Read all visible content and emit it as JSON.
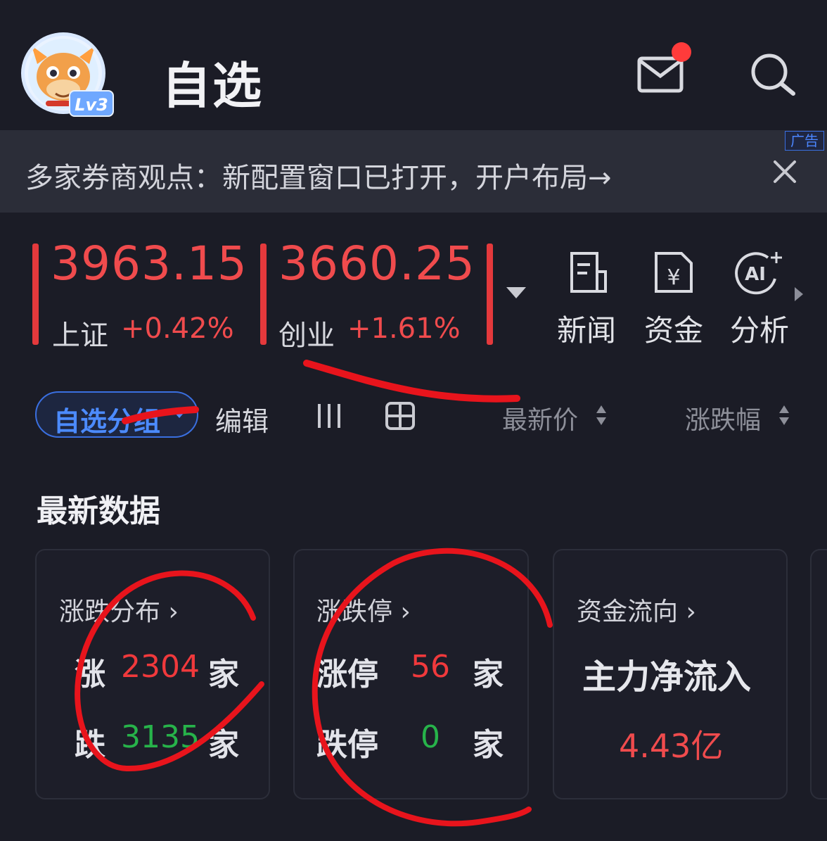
{
  "header": {
    "title": "自选",
    "level_badge": "Lv3",
    "icons": [
      "avatar",
      "mail-icon",
      "search-icon"
    ],
    "has_notification": true
  },
  "ad_banner": {
    "text": "多家券商观点：新配置窗口已打开，开户布局→",
    "tag": "广告"
  },
  "indices": [
    {
      "value": "3963.15",
      "name": "上证",
      "change": "+0.42%"
    },
    {
      "value": "3660.25",
      "name": "创业",
      "change": "+1.61%"
    }
  ],
  "tools": [
    {
      "label": "新闻",
      "icon": "news-icon"
    },
    {
      "label": "资金",
      "icon": "fund-yen-icon"
    },
    {
      "label": "分析",
      "icon": "ai-analysis-icon"
    }
  ],
  "filter_bar": {
    "group_label": "自选分组",
    "edit_label": "编辑",
    "sort_price": "最新价",
    "sort_change": "涨跌幅"
  },
  "section": {
    "title": "最新数据"
  },
  "cards": {
    "distribution": {
      "title": "涨跌分布",
      "rise_label": "涨",
      "rise_count": "2304",
      "fall_label": "跌",
      "fall_count": "3135",
      "unit": "家"
    },
    "limit": {
      "title": "涨跌停",
      "up_label": "涨停",
      "up_count": "56",
      "down_label": "跌停",
      "down_count": "0",
      "unit": "家"
    },
    "flow": {
      "title": "资金流向",
      "main_label": "主力净流入",
      "main_value": "4.43亿"
    }
  },
  "colors": {
    "background": "#1b1c26",
    "up_red": "#f0393c",
    "down_green": "#27b34a",
    "accent_blue": "#4c8bff",
    "annotation": "#e8141c"
  }
}
